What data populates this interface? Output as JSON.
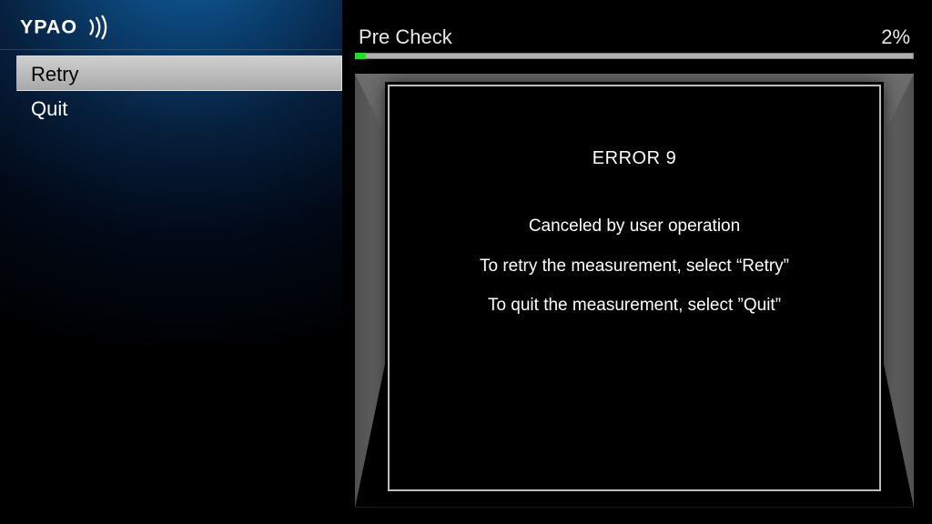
{
  "logo_text": "YPAO",
  "menu": {
    "items": [
      {
        "label": "Retry",
        "selected": true
      },
      {
        "label": "Quit",
        "selected": false
      }
    ]
  },
  "progress": {
    "label": "Pre Check",
    "value_text": "2%",
    "percent": 2
  },
  "dialog": {
    "title": "ERROR 9",
    "lines": [
      "Canceled by user operation",
      "To retry the measurement, select “Retry”",
      "To quit the measurement, select ”Quit”"
    ]
  }
}
